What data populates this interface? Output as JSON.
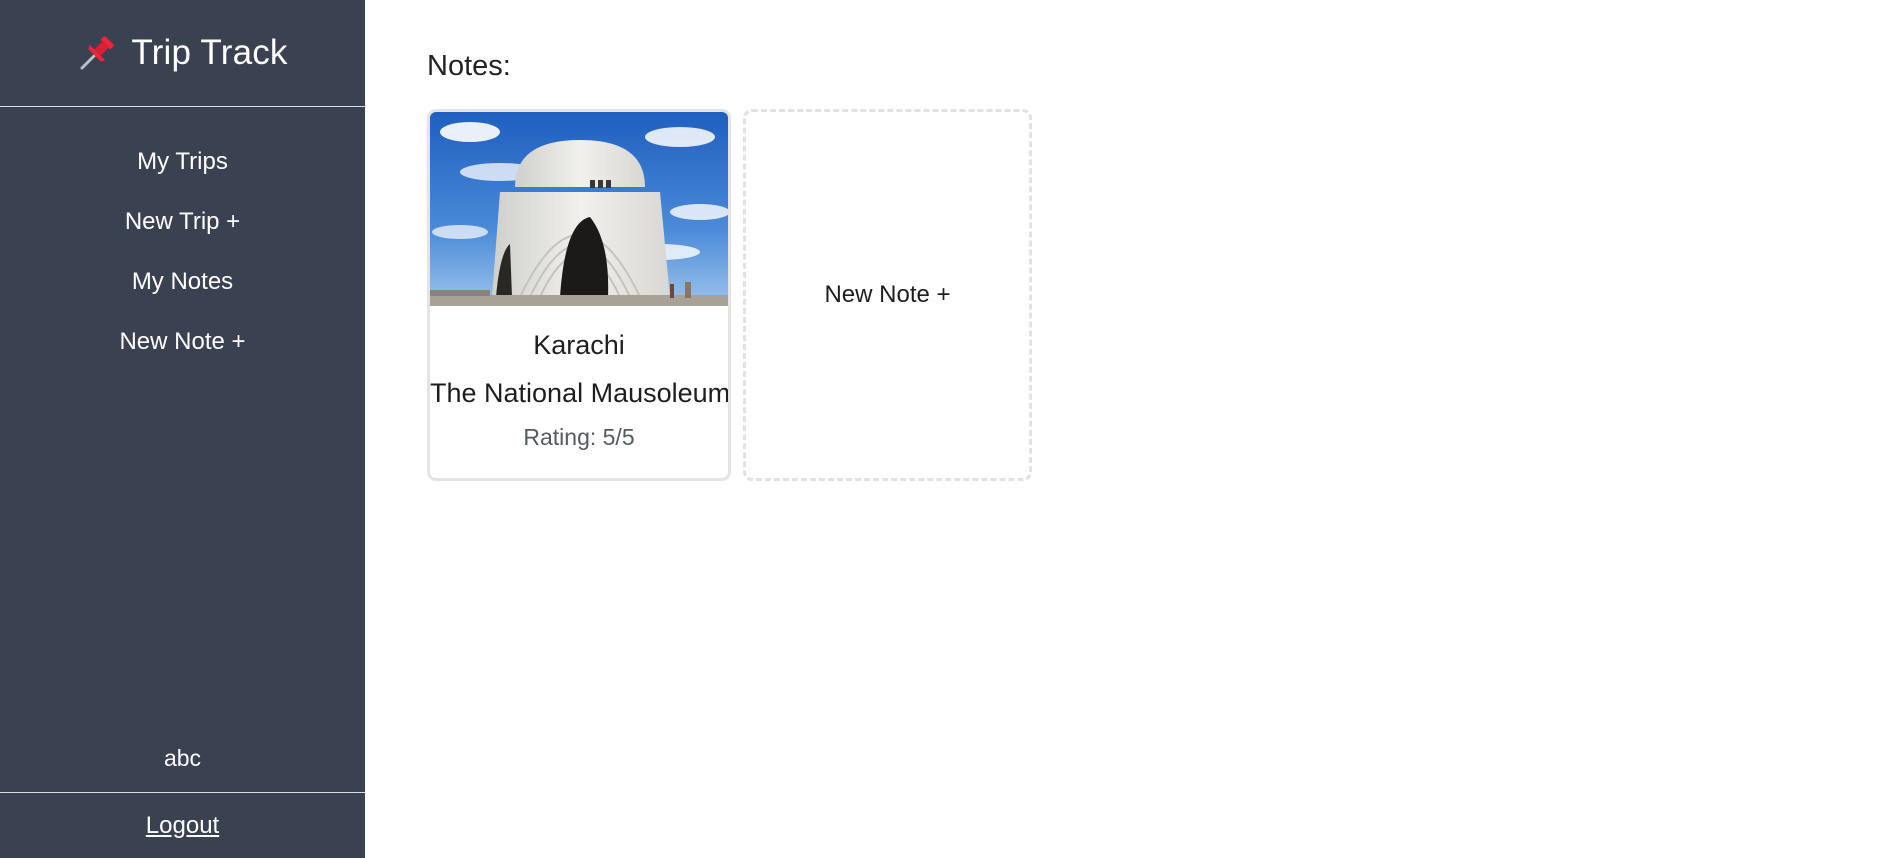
{
  "app": {
    "title": "Trip Track",
    "icon": "pushpin-icon",
    "accent_color": "#e8263e",
    "sidebar_color": "#3a4150"
  },
  "sidebar": {
    "items": [
      {
        "label": "My Trips"
      },
      {
        "label": "New Trip +"
      },
      {
        "label": "My Notes"
      },
      {
        "label": "New Note +"
      }
    ],
    "username": "abc",
    "logout_label": "Logout"
  },
  "main": {
    "section_title": "Notes:",
    "notes": [
      {
        "city": "Karachi",
        "place": "The National Mausoleum",
        "rating": "Rating: 5/5",
        "image": "mausoleum-photo"
      }
    ],
    "new_note_label": "New Note +"
  }
}
